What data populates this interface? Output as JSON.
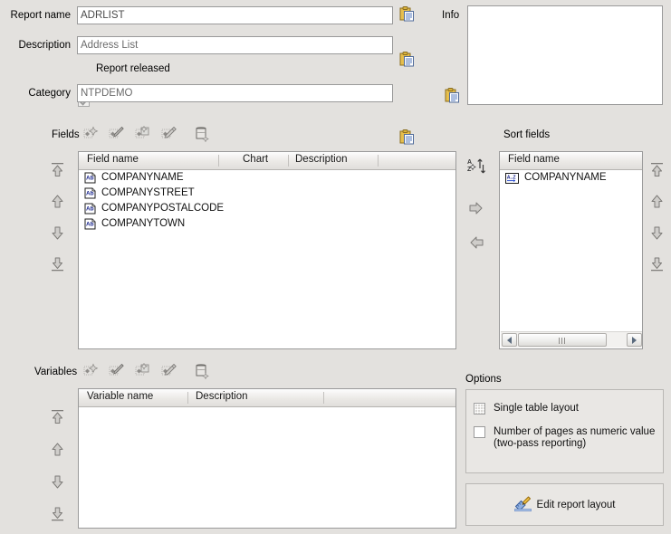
{
  "form": {
    "report_name_label": "Report name",
    "report_name_value": "ADRLIST",
    "description_label": "Description",
    "description_value": "Address List",
    "report_released_label": "Report released",
    "category_label": "Category",
    "category_value": "NTPDEMO",
    "info_label": "Info",
    "info_value": ""
  },
  "fields": {
    "label": "Fields",
    "toolbar": [
      {
        "name": "new-field-icon",
        "title": "New"
      },
      {
        "name": "edit-field-icon",
        "title": "Edit"
      },
      {
        "name": "copy-field-icon",
        "title": "Copy"
      },
      {
        "name": "delete-field-icon",
        "title": "Delete"
      },
      {
        "name": "database-field-icon",
        "title": "From database"
      }
    ],
    "columns": [
      "Field name",
      "Chart",
      "Description"
    ],
    "rows": [
      {
        "icon": "text-field-icon",
        "name": "COMPANYNAME",
        "chart": "",
        "description": ""
      },
      {
        "icon": "text-field-icon",
        "name": "COMPANYSTREET",
        "chart": "",
        "description": ""
      },
      {
        "icon": "text-field-icon",
        "name": "COMPANYPOSTALCODE",
        "chart": "",
        "description": ""
      },
      {
        "icon": "text-field-icon",
        "name": "COMPANYTOWN",
        "chart": "",
        "description": ""
      }
    ],
    "order_buttons": [
      "move-to-top",
      "move-up",
      "move-down",
      "move-to-bottom"
    ]
  },
  "sort": {
    "label": "Sort fields",
    "columns": [
      "Field name"
    ],
    "rows": [
      {
        "icon": "sort-az-icon",
        "name": "COMPANYNAME"
      }
    ],
    "transfer_buttons": [
      "sort-order-toggle",
      "add-to-sort",
      "remove-from-sort"
    ],
    "order_buttons": [
      "move-to-top",
      "move-up",
      "move-down",
      "move-to-bottom"
    ]
  },
  "variables": {
    "label": "Variables",
    "toolbar": [
      {
        "name": "new-variable-icon",
        "title": "New"
      },
      {
        "name": "edit-variable-icon",
        "title": "Edit"
      },
      {
        "name": "copy-variable-icon",
        "title": "Copy"
      },
      {
        "name": "delete-variable-icon",
        "title": "Delete"
      },
      {
        "name": "database-variable-icon",
        "title": "From database"
      }
    ],
    "columns": [
      "Variable name",
      "Description"
    ],
    "rows": [],
    "order_buttons": [
      "move-to-top",
      "move-up",
      "move-down",
      "move-to-bottom"
    ]
  },
  "options": {
    "label": "Options",
    "items": [
      {
        "label": "Single table layout",
        "checked": false,
        "disabled": true
      },
      {
        "label": "Number of pages as numeric value\n(two-pass reporting)",
        "line1": "Number of pages as numeric value",
        "line2": "(two-pass reporting)",
        "checked": false,
        "disabled": false
      }
    ]
  },
  "actions": {
    "edit_layout_label": "Edit report layout",
    "edit_layout_icon": "pencil-ruler-icon"
  },
  "colors": {
    "window_bg": "#e3e1de",
    "field_bg": "#ffffff",
    "border": "#9a9a9a",
    "header_grad_top": "#fdfdfd",
    "header_grad_bottom": "#e0dedb",
    "text": "#000000",
    "value_text": "#6b6b6b",
    "clipboard_yellow": "#e9c34a",
    "icon_blue": "#2b3f8f"
  }
}
